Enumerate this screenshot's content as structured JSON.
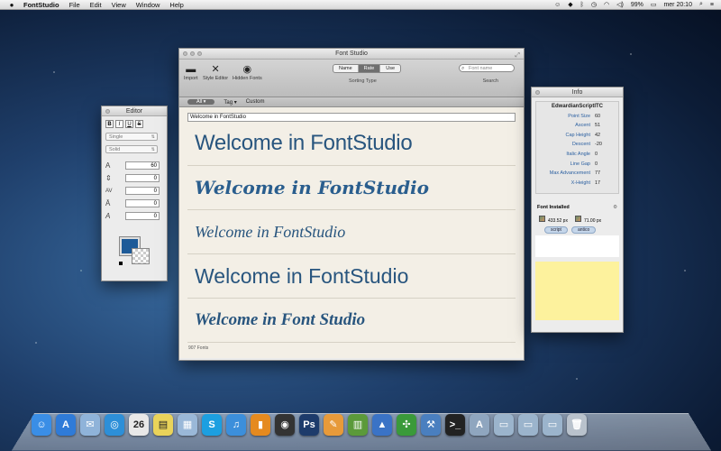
{
  "menubar": {
    "apple": "",
    "app": "FontStudio",
    "items": [
      "File",
      "Edit",
      "View",
      "Window",
      "Help"
    ],
    "battery": "99%",
    "clock": "mer 20:10"
  },
  "main_window": {
    "title": "Font Studio",
    "toolbar": {
      "import_label": "Import",
      "style_editor_label": "Style Editor",
      "hidden_fonts_label": "Hidden Fonts",
      "sorting": {
        "options": [
          "Name",
          "Rate",
          "Use"
        ],
        "selected": "Rate",
        "label": "Sorting Type"
      },
      "search": {
        "placeholder": "Font name",
        "label": "Search"
      }
    },
    "filterbar": {
      "all_label": "All",
      "tag_label": "Tag",
      "custom_label": "Custom"
    },
    "sample_text_value": "Welcome in FontStudio",
    "samples": [
      "Welcome in FontStudio",
      "Welcome in FontStudio",
      "Welcome in FontStudio",
      "Welcome in FontStudio",
      "Welcome in Font Studio"
    ],
    "font_count": "907 Fonts"
  },
  "editor": {
    "title": "Editor",
    "format_buttons": [
      "B",
      "I",
      "U",
      "S"
    ],
    "underline_style": "Single",
    "strike_style": "Solid",
    "rows": [
      {
        "icon": "font-size-icon",
        "glyph": "A",
        "value": "60"
      },
      {
        "icon": "line-spacing-icon",
        "glyph": "⇕",
        "value": "0"
      },
      {
        "icon": "kerning-icon",
        "glyph": "AV",
        "value": "0"
      },
      {
        "icon": "baseline-icon",
        "glyph": "Ā",
        "value": "0"
      },
      {
        "icon": "slant-icon",
        "glyph": "A",
        "value": "0"
      }
    ],
    "text_color": "#1d5a98"
  },
  "info": {
    "title": "Info",
    "font_name": "EdwardianScriptITC",
    "metrics": [
      {
        "label": "Point Size",
        "value": "60"
      },
      {
        "label": "Ascent",
        "value": "51"
      },
      {
        "label": "Cap Height",
        "value": "42"
      },
      {
        "label": "Descent",
        "value": "-20"
      },
      {
        "label": "Italic Angle",
        "value": "0"
      },
      {
        "label": "Line Gap",
        "value": "0"
      },
      {
        "label": "Max Advancement",
        "value": "77"
      },
      {
        "label": "X-Height",
        "value": "17"
      }
    ],
    "installed_label": "Font Installed",
    "width_px": "433.52 px",
    "height_px": "71.00 px",
    "tags": [
      "script",
      "antico"
    ],
    "note_color": "#fdf29d"
  },
  "dock": {
    "apps": [
      {
        "name": "finder-icon",
        "glyph": "☺",
        "color": "#3a8ee6"
      },
      {
        "name": "app-store-icon",
        "glyph": "A",
        "color": "#2f7bd8"
      },
      {
        "name": "mail-icon",
        "glyph": "✉",
        "color": "#8fb3d9"
      },
      {
        "name": "safari-icon",
        "glyph": "◎",
        "color": "#2d8fd8"
      },
      {
        "name": "calendar-icon",
        "glyph": "26",
        "color": "#e8e8e8"
      },
      {
        "name": "stickies-icon",
        "glyph": "▤",
        "color": "#e9d35a"
      },
      {
        "name": "preview-icon",
        "glyph": "▦",
        "color": "#9ab8d8"
      },
      {
        "name": "skype-icon",
        "glyph": "S",
        "color": "#1c9fe0"
      },
      {
        "name": "itunes-icon",
        "glyph": "♫",
        "color": "#3c8fdb"
      },
      {
        "name": "ibooks-icon",
        "glyph": "▮",
        "color": "#e58a1f"
      },
      {
        "name": "aperture-icon",
        "glyph": "◉",
        "color": "#333"
      },
      {
        "name": "photoshop-icon",
        "glyph": "Ps",
        "color": "#1d3b6b"
      },
      {
        "name": "pages-icon",
        "glyph": "✎",
        "color": "#e79a3a"
      },
      {
        "name": "numbers-icon",
        "glyph": "▥",
        "color": "#5b9a3a"
      },
      {
        "name": "keynote-icon",
        "glyph": "▲",
        "color": "#3a73c6"
      },
      {
        "name": "font-studio-icon",
        "glyph": "✣",
        "color": "#3a9a3a"
      },
      {
        "name": "xcode-icon",
        "glyph": "⚒",
        "color": "#4a7fbf"
      },
      {
        "name": "terminal-icon",
        "glyph": ">_",
        "color": "#222"
      },
      {
        "name": "applications-folder-icon",
        "glyph": "A",
        "color": "#8fa6bf"
      },
      {
        "name": "documents-folder-icon",
        "glyph": "▭",
        "color": "#9bb4cc"
      },
      {
        "name": "downloads-folder-icon",
        "glyph": "▭",
        "color": "#9bb4cc"
      },
      {
        "name": "desktop-folder-icon",
        "glyph": "▭",
        "color": "#9bb4cc"
      },
      {
        "name": "trash-icon",
        "glyph": "🗑",
        "color": "#b9c2cc"
      }
    ]
  }
}
